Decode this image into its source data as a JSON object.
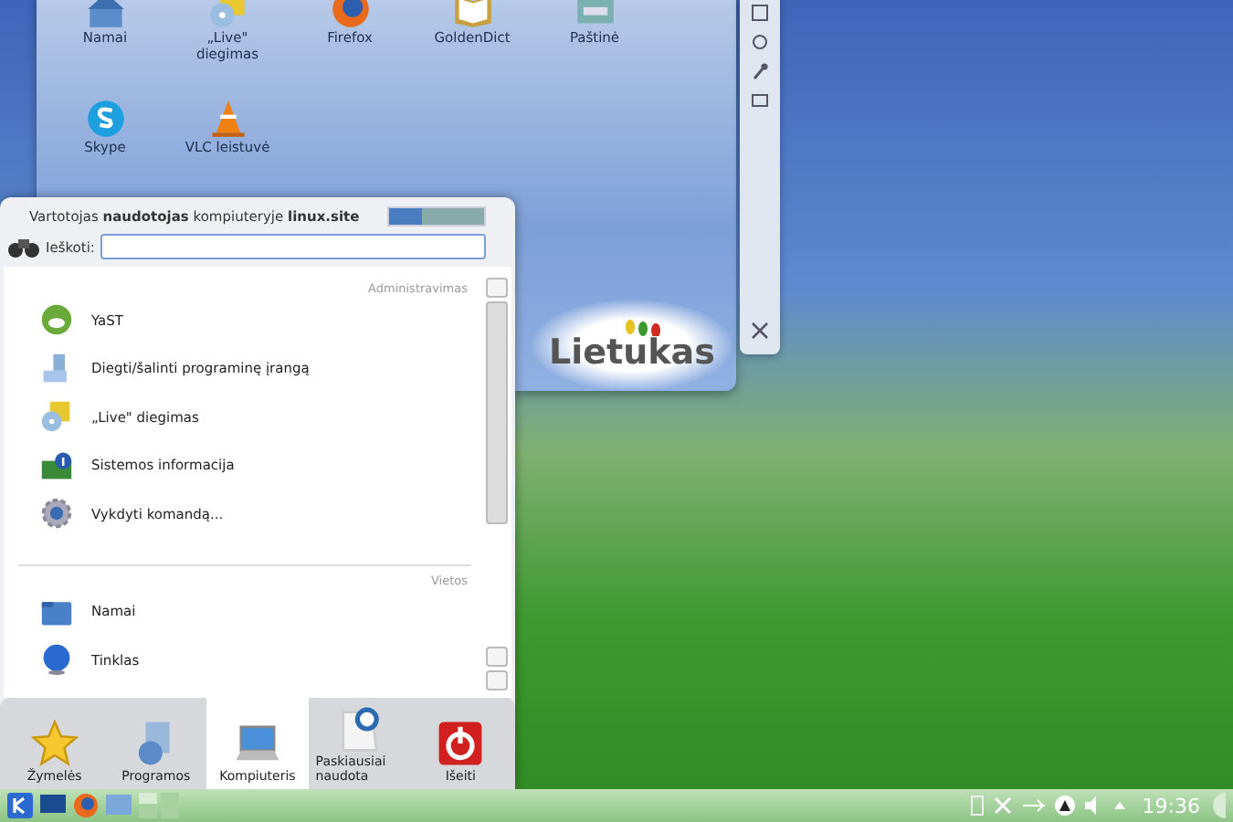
{
  "desktop_widget": {
    "icons": [
      {
        "label": "Namai",
        "kind": "home"
      },
      {
        "label": "„Live\" diegimas",
        "kind": "install"
      },
      {
        "label": "Firefox",
        "kind": "browser"
      },
      {
        "label": "GoldenDict",
        "kind": "book"
      },
      {
        "label": "Paštinė",
        "kind": "mail"
      },
      {
        "label": "Skype",
        "kind": "chat"
      },
      {
        "label": "VLC leistuvė",
        "kind": "cone"
      }
    ],
    "logo": "Lietukas"
  },
  "menu": {
    "header": "Vartotojas **naudotojas** kompiuteryje **linux.site**",
    "search_label": "Ieškoti:",
    "sections": [
      {
        "title": "Administravimas",
        "items": [
          {
            "label": "YaST",
            "kind": "yast"
          },
          {
            "label": "Diegti/šalinti programinę įrangą",
            "kind": "package"
          },
          {
            "label": "„Live\" diegimas",
            "kind": "install"
          },
          {
            "label": "Sistemos informacija",
            "kind": "info"
          },
          {
            "label": "Vykdyti komandą...",
            "kind": "gear"
          }
        ]
      },
      {
        "title": "Vietos",
        "items": [
          {
            "label": "Namai",
            "kind": "folder"
          },
          {
            "label": "Tinklas",
            "kind": "globe"
          }
        ]
      }
    ],
    "tabs": [
      {
        "label": "Žymelės",
        "kind": "star",
        "selected": false
      },
      {
        "label": "Programos",
        "kind": "apps",
        "selected": false
      },
      {
        "label": "Kompiuteris",
        "kind": "computer",
        "selected": true
      },
      {
        "label": "Paskiausiai naudota",
        "kind": "recent",
        "selected": false
      },
      {
        "label": "Išeiti",
        "kind": "leave",
        "selected": false
      }
    ]
  },
  "taskbar": {
    "clock": "19:36"
  }
}
